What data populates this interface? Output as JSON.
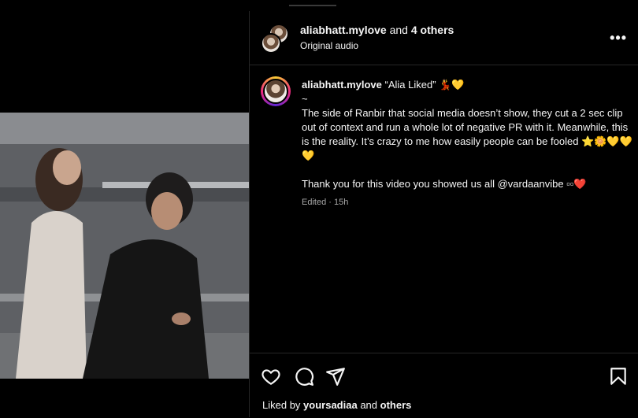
{
  "header": {
    "username": "aliabhatt.mylove",
    "and_text": "and",
    "others": "4 others",
    "audio": "Original audio",
    "more": "•••"
  },
  "caption": {
    "username": "aliabhatt.mylove",
    "title": "“Alia Liked” 💃💛",
    "body": "~\nThe side of Ranbir that social media doesn’t show, they cut a 2 sec clip out of context and run a whole lot of negative PR with it. Meanwhile, this is the reality. It’s crazy to me how easily people can be fooled ⭐🌼💛💛💛\n\nThank you for this video you showed us all @vardaanvibe ▫▫❤️",
    "meta": "Edited · 15h"
  },
  "likes": {
    "prefix": "Liked by",
    "user": "yoursadiaa",
    "and_text": "and",
    "others": "others"
  },
  "icons": [
    "heart-icon",
    "comment-icon",
    "share-icon",
    "bookmark-icon"
  ]
}
